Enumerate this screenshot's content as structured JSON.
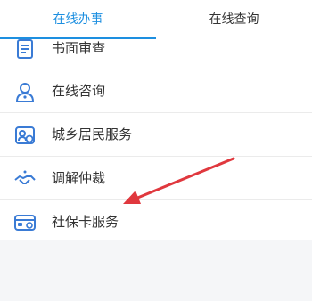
{
  "tabs": [
    {
      "label": "在线办事",
      "active": true
    },
    {
      "label": "在线查询",
      "active": false
    }
  ],
  "items": [
    {
      "label": "书面审查",
      "icon": "document-icon"
    },
    {
      "label": "在线咨询",
      "icon": "consultant-icon"
    },
    {
      "label": "城乡居民服务",
      "icon": "resident-service-icon"
    },
    {
      "label": "调解仲裁",
      "icon": "handshake-icon"
    },
    {
      "label": "社保卡服务",
      "icon": "social-security-card-icon"
    }
  ],
  "colors": {
    "accent": "#1d8fe0",
    "icon": "#3a7bd5",
    "arrow": "#e0383e"
  }
}
